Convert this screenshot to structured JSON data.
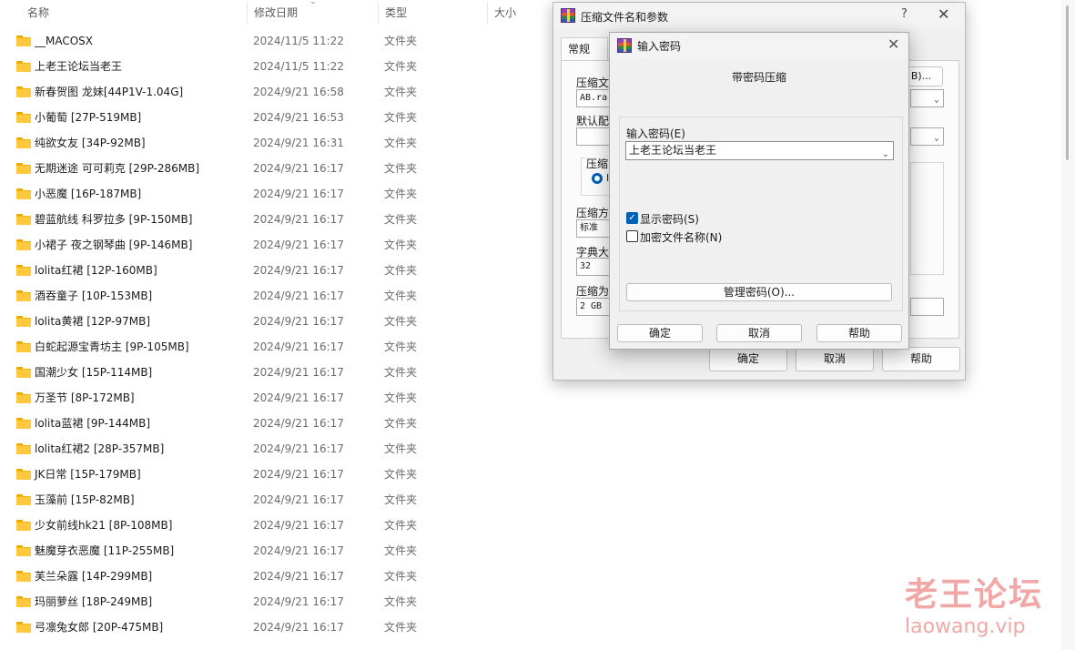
{
  "explorer": {
    "columns": {
      "name": "名称",
      "date": "修改日期",
      "type": "类型",
      "size": "大小"
    },
    "rows": [
      {
        "name": "__MACOSX",
        "date": "2024/11/5 11:22",
        "type": "文件夹"
      },
      {
        "name": "上老王论坛当老王",
        "date": "2024/11/5 11:22",
        "type": "文件夹"
      },
      {
        "name": "新春贺图 龙妹[44P1V-1.04G]",
        "date": "2024/9/21 16:58",
        "type": "文件夹"
      },
      {
        "name": "小葡萄 [27P-519MB]",
        "date": "2024/9/21 16:53",
        "type": "文件夹"
      },
      {
        "name": "纯欲女友 [34P-92MB]",
        "date": "2024/9/21 16:31",
        "type": "文件夹"
      },
      {
        "name": "无期迷途 可可莉克 [29P-286MB]",
        "date": "2024/9/21 16:17",
        "type": "文件夹"
      },
      {
        "name": "小恶魔 [16P-187MB]",
        "date": "2024/9/21 16:17",
        "type": "文件夹"
      },
      {
        "name": "碧蓝航线 科罗拉多 [9P-150MB]",
        "date": "2024/9/21 16:17",
        "type": "文件夹"
      },
      {
        "name": "小裙子 夜之钢琴曲 [9P-146MB]",
        "date": "2024/9/21 16:17",
        "type": "文件夹"
      },
      {
        "name": "lolita红裙 [12P-160MB]",
        "date": "2024/9/21 16:17",
        "type": "文件夹"
      },
      {
        "name": "酒吞童子 [10P-153MB]",
        "date": "2024/9/21 16:17",
        "type": "文件夹"
      },
      {
        "name": "lolita黄裙 [12P-97MB]",
        "date": "2024/9/21 16:17",
        "type": "文件夹"
      },
      {
        "name": "白蛇起源宝青坊主 [9P-105MB]",
        "date": "2024/9/21 16:17",
        "type": "文件夹"
      },
      {
        "name": "国潮少女 [15P-114MB]",
        "date": "2024/9/21 16:17",
        "type": "文件夹"
      },
      {
        "name": "万圣节 [8P-172MB]",
        "date": "2024/9/21 16:17",
        "type": "文件夹"
      },
      {
        "name": "lolita蓝裙 [9P-144MB]",
        "date": "2024/9/21 16:17",
        "type": "文件夹"
      },
      {
        "name": "lolita红裙2 [28P-357MB]",
        "date": "2024/9/21 16:17",
        "type": "文件夹"
      },
      {
        "name": "JK日常 [15P-179MB]",
        "date": "2024/9/21 16:17",
        "type": "文件夹"
      },
      {
        "name": "玉藻前 [15P-82MB]",
        "date": "2024/9/21 16:17",
        "type": "文件夹"
      },
      {
        "name": "少女前线hk21 [8P-108MB]",
        "date": "2024/9/21 16:17",
        "type": "文件夹"
      },
      {
        "name": "魅魔芽衣恶魔 [11P-255MB]",
        "date": "2024/9/21 16:17",
        "type": "文件夹"
      },
      {
        "name": "芙兰朵露 [14P-299MB]",
        "date": "2024/9/21 16:17",
        "type": "文件夹"
      },
      {
        "name": "玛丽萝丝 [18P-249MB]",
        "date": "2024/9/21 16:17",
        "type": "文件夹"
      },
      {
        "name": "弓凛兔女郎 [20P-475MB]",
        "date": "2024/9/21 16:17",
        "type": "文件夹"
      }
    ]
  },
  "archive_dialog": {
    "title": "压缩文件名和参数",
    "help_glyph": "?",
    "close_glyph": "✕",
    "tab_general": "常规",
    "label_archive_name": "压缩文",
    "archive_name_value": "AB.ra",
    "browse_partial": "B)...",
    "label_default_profile": "默认配",
    "label_format_group": "压缩",
    "format_radio_partial": "I",
    "label_method": "压缩方",
    "method_value": "标准",
    "label_dict": "字典大",
    "dict_value": "32",
    "label_split": "压缩为",
    "split_value": "2 GB",
    "ok": "确定",
    "cancel": "取消",
    "help": "帮助"
  },
  "password_dialog": {
    "title": "输入密码",
    "heading": "带密码压缩",
    "password_label": "输入密码(E)",
    "password_value": "上老王论坛当老王",
    "show_password": "显示密码(S)",
    "show_password_checked": true,
    "encrypt_names": "加密文件名称(N)",
    "encrypt_names_checked": false,
    "manage_button": "管理密码(O)...",
    "ok": "确定",
    "cancel": "取消",
    "help": "帮助",
    "close_glyph": "✕"
  },
  "watermark": {
    "text": "老王论坛",
    "url": "laowang.vip"
  }
}
